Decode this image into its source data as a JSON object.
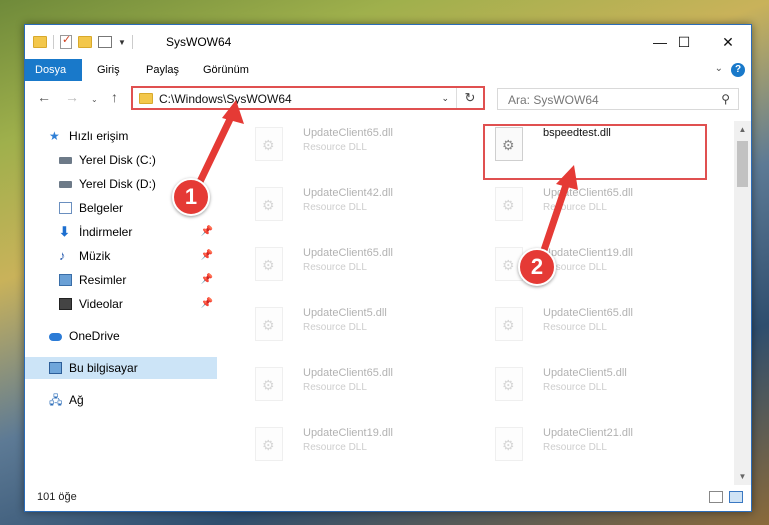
{
  "window": {
    "title": "SysWOW64",
    "controls": {
      "minimize": "—",
      "maximize": "☐",
      "close": "✕"
    }
  },
  "ribbon": {
    "tabs": [
      "Dosya",
      "Giriş",
      "Paylaş",
      "Görünüm"
    ],
    "help": "?"
  },
  "address": {
    "path": "C:\\Windows\\SysWOW64",
    "refresh_icon": "refresh-icon"
  },
  "search": {
    "placeholder": "Ara: SysWOW64"
  },
  "sidebar": {
    "items": [
      {
        "label": "Hızlı erişim",
        "icon": "star-icon"
      },
      {
        "label": "Yerel Disk (C:)",
        "icon": "drive-icon"
      },
      {
        "label": "Yerel Disk (D:)",
        "icon": "drive-icon"
      },
      {
        "label": "Belgeler",
        "icon": "document-icon"
      },
      {
        "label": "İndirmeler",
        "icon": "download-icon"
      },
      {
        "label": "Müzik",
        "icon": "music-icon"
      },
      {
        "label": "Resimler",
        "icon": "picture-icon"
      },
      {
        "label": "Videolar",
        "icon": "video-icon"
      },
      {
        "label": "OneDrive",
        "icon": "cloud-icon"
      },
      {
        "label": "Bu bilgisayar",
        "icon": "computer-icon"
      },
      {
        "label": "Ağ",
        "icon": "network-icon"
      }
    ]
  },
  "files": {
    "left_column": [
      {
        "name": "UpdateClient65.dll",
        "type": "Resource DLL"
      },
      {
        "name": "UpdateClient42.dll",
        "type": "Resource DLL"
      },
      {
        "name": "UpdateClient65.dll",
        "type": "Resource DLL"
      },
      {
        "name": "UpdateClient5.dll",
        "type": "Resource DLL"
      },
      {
        "name": "UpdateClient65.dll",
        "type": "Resource DLL"
      },
      {
        "name": "UpdateClient19.dll",
        "type": "Resource DLL"
      }
    ],
    "right_column": [
      {
        "name": "bspeedtest.dll",
        "type": ""
      },
      {
        "name": "UpdateClient65.dll",
        "type": "Resource DLL"
      },
      {
        "name": "UpdateClient19.dll",
        "type": "Resource DLL"
      },
      {
        "name": "UpdateClient65.dll",
        "type": "Resource DLL"
      },
      {
        "name": "UpdateClient5.dll",
        "type": "Resource DLL"
      },
      {
        "name": "UpdateClient21.dll",
        "type": "Resource DLL"
      }
    ]
  },
  "status": {
    "count": "101 öğe"
  },
  "markers": {
    "first": "1",
    "second": "2"
  },
  "colors": {
    "accent": "#1979ca",
    "annotation": "#e53a35",
    "selected": "#cce4f7"
  }
}
